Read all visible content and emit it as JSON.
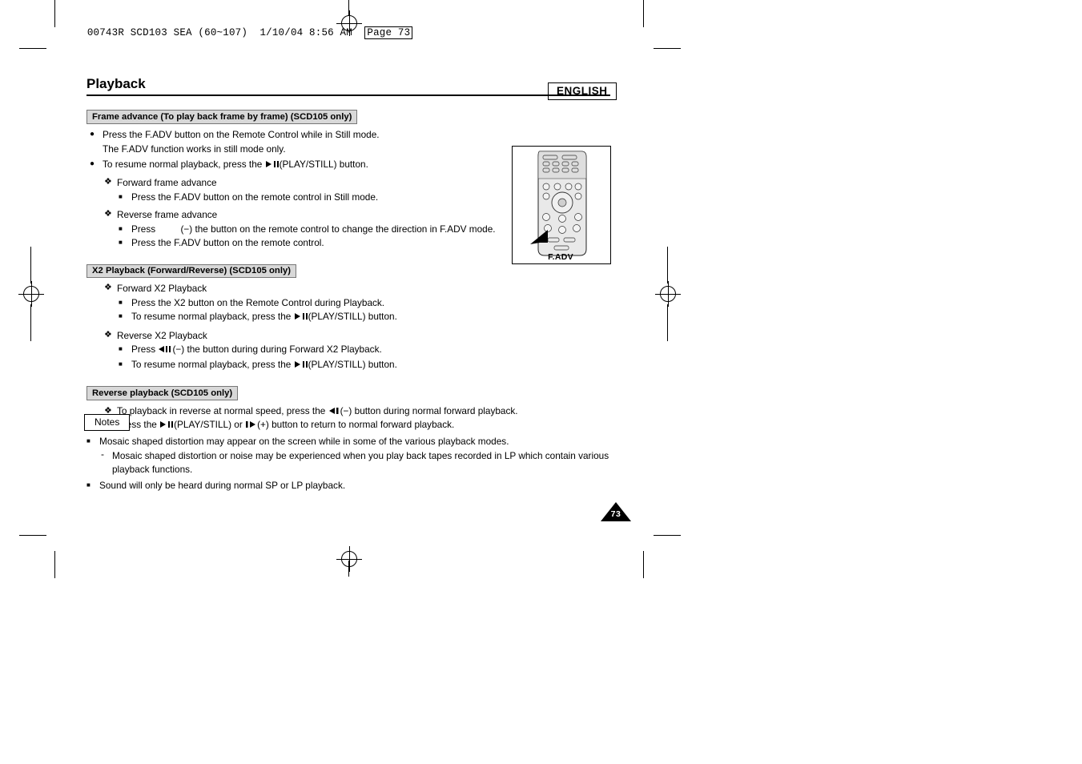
{
  "slug": {
    "text": "00743R SCD103 SEA (60~107)  1/10/04 8:56 AM",
    "page_label": "Page 73"
  },
  "header": {
    "language_badge": "ENGLISH",
    "chapter_title": "Playback"
  },
  "sections": [
    {
      "heading": "Frame advance (To play back frame by frame) (SCD105 only)",
      "items": [
        {
          "level": 1,
          "bullet": "disc",
          "text": "Press the F.ADV button on the Remote Control while in Still mode."
        },
        {
          "level": 1,
          "bullet": "none",
          "text": "The F.ADV function works in still mode only."
        },
        {
          "level": 1,
          "bullet": "disc",
          "text_pre": "To resume normal playback, press the ",
          "glyph": "play-still",
          "text_post": "(PLAY/STILL) button."
        },
        {
          "level": 2,
          "bullet": "flower",
          "text": "Forward frame advance"
        },
        {
          "level": 3,
          "bullet": "square",
          "text": "Press the F.ADV button on the remote control in Still mode."
        },
        {
          "level": 2,
          "bullet": "flower",
          "text": "Reverse frame advance"
        },
        {
          "level": 3,
          "bullet": "square",
          "text_pre": "Press ",
          "glyph": "rev-gap",
          "text_post": "(−) the button on the remote control to change the direction in F.ADV mode."
        },
        {
          "level": 3,
          "bullet": "square",
          "text": "Press the F.ADV button on the remote control."
        }
      ]
    },
    {
      "heading": "X2 Playback (Forward/Reverse) (SCD105 only)",
      "items": [
        {
          "level": 2,
          "bullet": "flower",
          "text": "Forward X2 Playback"
        },
        {
          "level": 3,
          "bullet": "square",
          "text": "Press the X2 button on the Remote Control during Playback."
        },
        {
          "level": 3,
          "bullet": "square",
          "text_pre": "To resume normal playback, press the ",
          "glyph": "play-still",
          "text_post": "(PLAY/STILL) button."
        },
        {
          "level": 2,
          "bullet": "flower",
          "text": "Reverse X2 Playback"
        },
        {
          "level": 3,
          "bullet": "square",
          "text_pre": "Press ",
          "glyph": "rev-x2",
          "text_post": "(−) the button during during Forward X2 Playback."
        },
        {
          "level": 3,
          "bullet": "square",
          "text_pre": "To resume normal playback, press the ",
          "glyph": "play-still",
          "text_post": "(PLAY/STILL) button."
        }
      ]
    },
    {
      "heading": "Reverse playback (SCD105 only)",
      "items": [
        {
          "level": 2,
          "bullet": "flower",
          "text_pre": "To playback in reverse at normal speed, press the ",
          "glyph": "rev-still",
          "text_post": "(−) button during normal forward playback."
        },
        {
          "level": 2,
          "bullet": "flower",
          "text_pre": "Press the ",
          "glyph": "play-still",
          "text_mid": "(PLAY/STILL) or ",
          "glyph2": "fwd-still",
          "text_post": "(+) button to return to normal forward playback."
        }
      ]
    }
  ],
  "notes": {
    "label": "Notes",
    "items": [
      {
        "bullet": "square",
        "text": "Mosaic shaped distortion may appear on the screen while in some of the various playback modes."
      },
      {
        "bullet": "dash",
        "text": "Mosaic shaped distortion or noise may be experienced when you play back tapes recorded in LP which contain various"
      },
      {
        "bullet": "none",
        "text": "playback functions."
      },
      {
        "bullet": "square",
        "text": "Sound will only be heard during normal SP or LP playback."
      }
    ]
  },
  "figure": {
    "caption": "F.ADV",
    "name": "remote-control-illustration"
  },
  "page_number": "73"
}
